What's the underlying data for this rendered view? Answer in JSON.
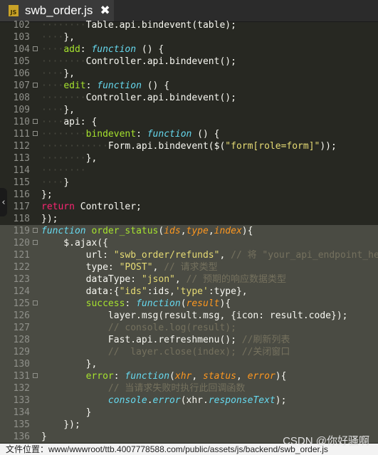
{
  "tab": {
    "title": "swb_order.js",
    "icon": "JS",
    "close_label": "✖"
  },
  "lines": [
    {
      "num": "102",
      "indent": "········",
      "tokens": [
        [
          "pl",
          "Table.api.bindevent(table);"
        ]
      ]
    },
    {
      "num": "103",
      "indent": "····",
      "tokens": [
        [
          "pl",
          "},"
        ]
      ]
    },
    {
      "num": "104",
      "indent": "····",
      "tokens": [
        [
          "fn",
          "add"
        ],
        [
          "pl",
          ": "
        ],
        [
          "kw",
          "function"
        ],
        [
          "pl",
          " () {"
        ]
      ]
    },
    {
      "num": "105",
      "indent": "········",
      "tokens": [
        [
          "pl",
          "Controller.api.bindevent();"
        ]
      ]
    },
    {
      "num": "106",
      "indent": "····",
      "tokens": [
        [
          "pl",
          "},"
        ]
      ]
    },
    {
      "num": "107",
      "indent": "····",
      "tokens": [
        [
          "fn",
          "edit"
        ],
        [
          "pl",
          ": "
        ],
        [
          "kw",
          "function"
        ],
        [
          "pl",
          " () {"
        ]
      ]
    },
    {
      "num": "108",
      "indent": "········",
      "tokens": [
        [
          "pl",
          "Controller.api.bindevent();"
        ]
      ]
    },
    {
      "num": "109",
      "indent": "····",
      "tokens": [
        [
          "pl",
          "},"
        ]
      ]
    },
    {
      "num": "110",
      "indent": "····",
      "tokens": [
        [
          "pl",
          "api: {"
        ]
      ]
    },
    {
      "num": "111",
      "indent": "········",
      "tokens": [
        [
          "fn",
          "bindevent"
        ],
        [
          "pl",
          ": "
        ],
        [
          "kw",
          "function"
        ],
        [
          "pl",
          " () {"
        ]
      ]
    },
    {
      "num": "112",
      "indent": "············",
      "tokens": [
        [
          "pl",
          "Form.api.bindevent($("
        ],
        [
          "str",
          "\"form[role=form]\""
        ],
        [
          "pl",
          "));"
        ]
      ]
    },
    {
      "num": "113",
      "indent": "········",
      "tokens": [
        [
          "pl",
          "},"
        ]
      ]
    },
    {
      "num": "114",
      "indent": "········",
      "tokens": []
    },
    {
      "num": "115",
      "indent": "····",
      "tokens": [
        [
          "pl",
          "}"
        ]
      ]
    },
    {
      "num": "116",
      "indent": "",
      "tokens": [
        [
          "pl",
          "};"
        ]
      ]
    },
    {
      "num": "117",
      "indent": "",
      "tokens": [
        [
          "ret",
          "return"
        ],
        [
          "pl",
          " Controller;"
        ]
      ]
    },
    {
      "num": "118",
      "indent": "",
      "tokens": [
        [
          "pl",
          "});"
        ]
      ]
    },
    {
      "num": "119",
      "indent": "",
      "hl": true,
      "tokens": [
        [
          "kw",
          "function"
        ],
        [
          "pl",
          " "
        ],
        [
          "fn",
          "order_status"
        ],
        [
          "pl",
          "("
        ],
        [
          "arg",
          "ids"
        ],
        [
          "pl",
          ","
        ],
        [
          "arg",
          "type"
        ],
        [
          "pl",
          ","
        ],
        [
          "arg",
          "index"
        ],
        [
          "pl",
          "){"
        ]
      ]
    },
    {
      "num": "120",
      "indent": "",
      "hl": true,
      "tokens": [
        [
          "pl",
          "    $.ajax({"
        ]
      ]
    },
    {
      "num": "121",
      "indent": "",
      "hl": true,
      "tokens": [
        [
          "pl",
          "        url: "
        ],
        [
          "str",
          "\"swb_order/refunds\""
        ],
        [
          "pl",
          ", "
        ],
        [
          "cm",
          "// 将 \"your_api_endpoint_here\""
        ]
      ]
    },
    {
      "num": "122",
      "indent": "",
      "hl": true,
      "tokens": [
        [
          "pl",
          "        type: "
        ],
        [
          "str",
          "\"POST\""
        ],
        [
          "pl",
          ", "
        ],
        [
          "cm",
          "// 请求类型"
        ]
      ]
    },
    {
      "num": "123",
      "indent": "",
      "hl": true,
      "tokens": [
        [
          "pl",
          "        dataType: "
        ],
        [
          "str",
          "\"json\""
        ],
        [
          "pl",
          ", "
        ],
        [
          "cm",
          "// 预期的响应数据类型"
        ]
      ]
    },
    {
      "num": "124",
      "indent": "",
      "hl": true,
      "tokens": [
        [
          "pl",
          "        data:{"
        ],
        [
          "str",
          "\"ids\""
        ],
        [
          "pl",
          ":ids,"
        ],
        [
          "str",
          "'type'"
        ],
        [
          "pl",
          ":type},"
        ]
      ]
    },
    {
      "num": "125",
      "indent": "",
      "hl": true,
      "tokens": [
        [
          "pl",
          "        "
        ],
        [
          "fn",
          "success"
        ],
        [
          "pl",
          ": "
        ],
        [
          "kw",
          "function"
        ],
        [
          "pl",
          "("
        ],
        [
          "arg",
          "result"
        ],
        [
          "pl",
          "){"
        ]
      ]
    },
    {
      "num": "126",
      "indent": "",
      "hl": true,
      "tokens": [
        [
          "pl",
          "            layer.msg(result.msg, {icon: result.code});"
        ]
      ]
    },
    {
      "num": "127",
      "indent": "",
      "hl": true,
      "tokens": [
        [
          "pl",
          "            "
        ],
        [
          "cm",
          "// console.log(result);"
        ]
      ]
    },
    {
      "num": "128",
      "indent": "",
      "hl": true,
      "tokens": [
        [
          "pl",
          "            Fast.api.refreshmenu(); "
        ],
        [
          "cm",
          "//刷新列表"
        ]
      ]
    },
    {
      "num": "129",
      "indent": "",
      "hl": true,
      "tokens": [
        [
          "pl",
          "            "
        ],
        [
          "cm",
          "//  layer.close(index); //关闭窗口"
        ]
      ]
    },
    {
      "num": "130",
      "indent": "",
      "hl": true,
      "tokens": [
        [
          "pl",
          "        },"
        ]
      ]
    },
    {
      "num": "131",
      "indent": "",
      "hl": true,
      "tokens": [
        [
          "pl",
          "        "
        ],
        [
          "fn",
          "error"
        ],
        [
          "pl",
          ": "
        ],
        [
          "kw",
          "function"
        ],
        [
          "pl",
          "("
        ],
        [
          "arg",
          "xhr"
        ],
        [
          "pl",
          ", "
        ],
        [
          "arg",
          "status"
        ],
        [
          "pl",
          ", "
        ],
        [
          "arg",
          "error"
        ],
        [
          "pl",
          "){"
        ]
      ]
    },
    {
      "num": "132",
      "indent": "",
      "hl": true,
      "tokens": [
        [
          "pl",
          "            "
        ],
        [
          "cm",
          "// 当请求失败时执行此回调函数"
        ]
      ]
    },
    {
      "num": "133",
      "indent": "",
      "hl": true,
      "tokens": [
        [
          "pl",
          "            "
        ],
        [
          "kw",
          "console"
        ],
        [
          "pl",
          "."
        ],
        [
          "kw",
          "error"
        ],
        [
          "pl",
          "(xhr."
        ],
        [
          "kw",
          "responseText"
        ],
        [
          "pl",
          ");"
        ]
      ]
    },
    {
      "num": "134",
      "indent": "",
      "hl": true,
      "tokens": [
        [
          "pl",
          "        }"
        ]
      ]
    },
    {
      "num": "135",
      "indent": "",
      "hl": true,
      "tokens": [
        [
          "pl",
          "    });"
        ]
      ]
    },
    {
      "num": "136",
      "indent": "",
      "hl": true,
      "tokens": [
        [
          "pl",
          "}"
        ]
      ]
    }
  ],
  "status": {
    "path": "文件位置：www/wwwroot/ttb.4007778588.com/public/assets/js/backend/swb_order.js"
  },
  "watermark": "CSDN @你好骚啊"
}
